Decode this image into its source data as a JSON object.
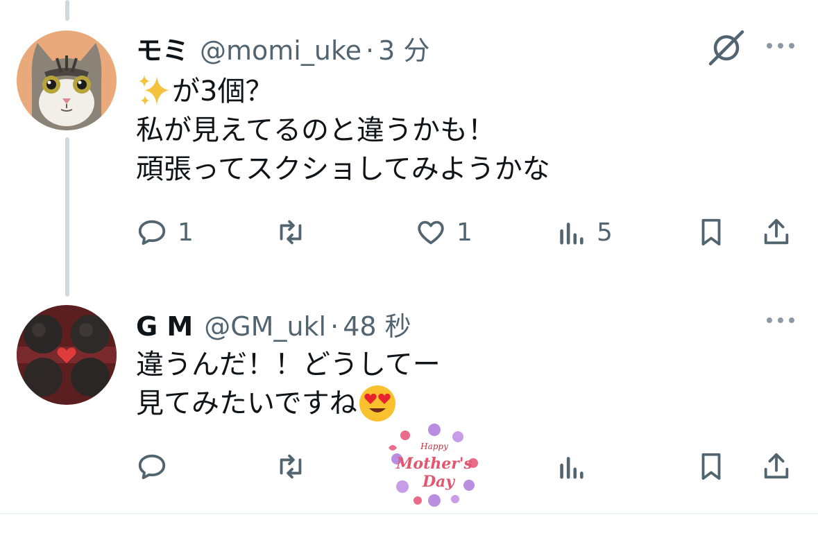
{
  "tweets": [
    {
      "name": "モミ",
      "handle": "@momi_uke",
      "separator": "·",
      "time": "3 分",
      "lines": [
        "が3個？",
        "私が見えてるのと違うかも！",
        "頑張ってスクショしてみようかな"
      ],
      "line1_emoji": "sparkles",
      "actions": {
        "reply": "1",
        "retweet": "",
        "like": "1",
        "views": "5"
      }
    },
    {
      "name": "G M",
      "handle": "@GM_ukl",
      "separator": "·",
      "time": "48 秒",
      "lines": [
        "違うんだ！！どうしてー",
        "見てみたいですね"
      ],
      "line2_emoji": "heart-eyes",
      "actions": {
        "reply": "",
        "retweet": "",
        "like": "",
        "views": ""
      },
      "sticker_text": [
        "Happy",
        "Mother's",
        "Day"
      ]
    }
  ],
  "icons": [
    "grok-icon",
    "more-icon",
    "reply-icon",
    "retweet-icon",
    "like-icon",
    "views-icon",
    "bookmark-icon",
    "share-icon"
  ],
  "colors": {
    "text": "#0f1419",
    "secondary": "#536471",
    "thread": "#cfd9de"
  }
}
